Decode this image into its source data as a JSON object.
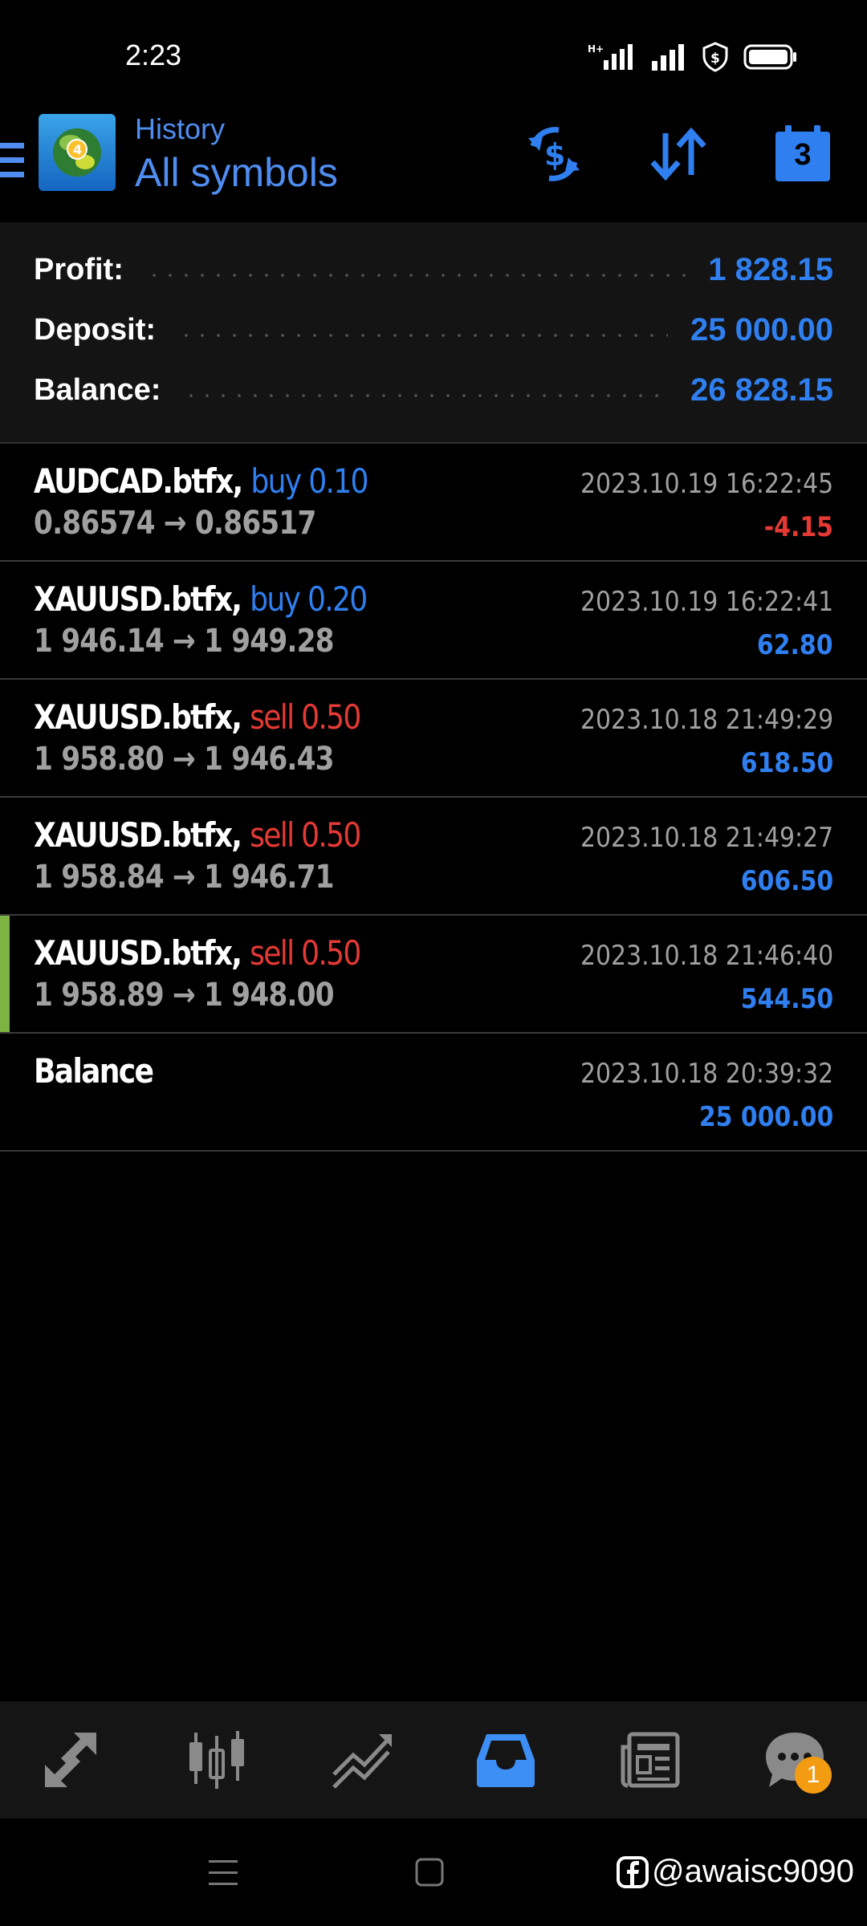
{
  "status": {
    "time": "2:23"
  },
  "header": {
    "subtitle": "History",
    "title": "All symbols",
    "calendar_number": "3"
  },
  "summary": {
    "profit_label": "Profit:",
    "profit_value": "1 828.15",
    "deposit_label": "Deposit:",
    "deposit_value": "25 000.00",
    "balance_label": "Balance:",
    "balance_value": "26 828.15"
  },
  "trades": [
    {
      "symbol": "AUDCAD.btfx,",
      "direction": "buy 0.10",
      "type": "buy",
      "prices": "0.86574 → 0.86517",
      "time": "2023.10.19 16:22:45",
      "profit": "-4.15",
      "sign": "neg"
    },
    {
      "symbol": "XAUUSD.btfx,",
      "direction": "buy 0.20",
      "type": "buy",
      "prices": "1 946.14 → 1 949.28",
      "time": "2023.10.19 16:22:41",
      "profit": "62.80",
      "sign": "pos"
    },
    {
      "symbol": "XAUUSD.btfx,",
      "direction": "sell 0.50",
      "type": "sell",
      "prices": "1 958.80 → 1 946.43",
      "time": "2023.10.18 21:49:29",
      "profit": "618.50",
      "sign": "pos"
    },
    {
      "symbol": "XAUUSD.btfx,",
      "direction": "sell 0.50",
      "type": "sell",
      "prices": "1 958.84 → 1 946.71",
      "time": "2023.10.18 21:49:27",
      "profit": "606.50",
      "sign": "pos"
    },
    {
      "symbol": "XAUUSD.btfx,",
      "direction": "sell 0.50",
      "type": "sell",
      "prices": "1 958.89 → 1 948.00",
      "time": "2023.10.18 21:46:40",
      "profit": "544.50",
      "sign": "pos",
      "marked": true
    }
  ],
  "balance_entry": {
    "label": "Balance",
    "time": "2023.10.18 20:39:32",
    "amount": "25 000.00"
  },
  "bottom_nav": {
    "chat_badge": "1",
    "active": "history"
  },
  "watermark": {
    "handle": "@awaisc9090"
  },
  "colors": {
    "accent_blue": "#2f7ff0",
    "loss_red": "#e53935",
    "marker_green": "#7cb342",
    "badge_orange": "#f39c12"
  }
}
